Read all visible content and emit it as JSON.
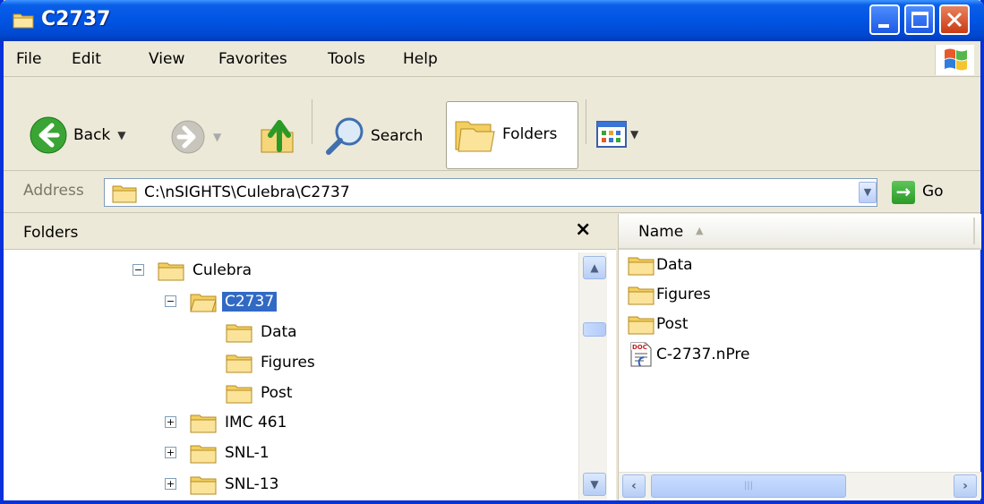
{
  "window": {
    "title": "C2737"
  },
  "menu": {
    "file": "File",
    "edit": "Edit",
    "view": "View",
    "favorites": "Favorites",
    "tools": "Tools",
    "help": "Help"
  },
  "toolbar": {
    "back": "Back",
    "search": "Search",
    "folders": "Folders"
  },
  "address": {
    "label": "Address",
    "path": "C:\\nSIGHTS\\Culebra\\C2737",
    "go": "Go"
  },
  "folders_pane": {
    "title": "Folders",
    "close_glyph": "×",
    "tree": [
      {
        "label": "Culebra",
        "expander": "−"
      },
      {
        "label": "C2737",
        "expander": "−"
      },
      {
        "label": "Data"
      },
      {
        "label": "Figures"
      },
      {
        "label": "Post"
      },
      {
        "label": "IMC 461",
        "expander": "+"
      },
      {
        "label": "SNL-1",
        "expander": "+"
      },
      {
        "label": "SNL-13",
        "expander": "+"
      }
    ]
  },
  "contents_pane": {
    "column_name": "Name",
    "items": [
      {
        "label": "Data",
        "icon": "folder-icon"
      },
      {
        "label": "Figures",
        "icon": "folder-icon"
      },
      {
        "label": "Post",
        "icon": "folder-icon"
      },
      {
        "label": "C-2737.nPre",
        "icon": "document-icon"
      }
    ]
  },
  "colors": {
    "titlebar": "#0054e3",
    "selection": "#316ac5",
    "folder": "#f3d46a"
  }
}
